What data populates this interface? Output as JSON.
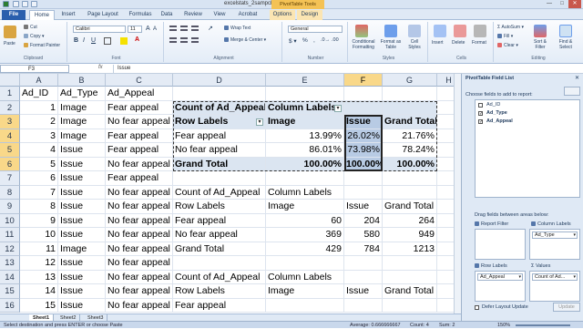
{
  "window": {
    "title": "excelstats_2sampchisq - Microsoft Excel",
    "context_tab": "PivotTable Tools",
    "controls": [
      "—",
      "□",
      "✕"
    ]
  },
  "tabs": [
    "File",
    "Home",
    "Insert",
    "Page Layout",
    "Formulas",
    "Data",
    "Review",
    "View",
    "Acrobat",
    "Options",
    "Design"
  ],
  "ribbon": {
    "clipboard": {
      "paste": "Paste",
      "cut": "Cut",
      "copy": "Copy ▾",
      "format_painter": "Format Painter",
      "label": "Clipboard"
    },
    "font": {
      "name": "Calibri",
      "size": "11",
      "label": "Font"
    },
    "alignment": {
      "wrap": "Wrap Text",
      "merge": "Merge & Center ▾",
      "label": "Alignment"
    },
    "number": {
      "format": "General",
      "label": "Number"
    },
    "styles": {
      "conditional": "Conditional Formatting",
      "format_table": "Format as Table",
      "cell_styles": "Cell Styles",
      "label": "Styles"
    },
    "cells": {
      "insert": "Insert",
      "delete": "Delete",
      "format": "Format",
      "label": "Cells"
    },
    "editing": {
      "autosum": "AutoSum ▾",
      "fill": "Fill ▾",
      "clear": "Clear ▾",
      "sort": "Sort & Filter",
      "find": "Find & Select",
      "label": "Editing"
    }
  },
  "formula_bar": {
    "name_box": "F3",
    "fx": "fx",
    "content": "Issue"
  },
  "columns": [
    "A",
    "B",
    "C",
    "D",
    "E",
    "F",
    "G",
    "H"
  ],
  "rows": [
    {
      "n": "1",
      "A": "Ad_ID",
      "B": "Ad_Type",
      "C": "Ad_Appeal",
      "D": "",
      "E": "",
      "F": "",
      "G": ""
    },
    {
      "n": "2",
      "A": "1",
      "B": "Image",
      "C": "Fear appeal",
      "D": "Count of Ad_Appeal",
      "E": "Column Labels",
      "F": "",
      "G": ""
    },
    {
      "n": "3",
      "A": "2",
      "B": "Image",
      "C": "No fear appeal",
      "D": "Row Labels",
      "E": "Image",
      "F": "Issue",
      "G": "Grand Total"
    },
    {
      "n": "4",
      "A": "3",
      "B": "Image",
      "C": "Fear appeal",
      "D": "Fear appeal",
      "E": "13.99%",
      "F": "26.02%",
      "G": "21.76%"
    },
    {
      "n": "5",
      "A": "4",
      "B": "Issue",
      "C": "Fear appeal",
      "D": "No fear appeal",
      "E": "86.01%",
      "F": "73.98%",
      "G": "78.24%"
    },
    {
      "n": "6",
      "A": "5",
      "B": "Issue",
      "C": "No fear appeal",
      "D": "Grand Total",
      "E": "100.00%",
      "F": "100.00%",
      "G": "100.00%"
    },
    {
      "n": "7",
      "A": "6",
      "B": "Issue",
      "C": "Fear appeal",
      "D": "",
      "E": "",
      "F": "",
      "G": ""
    },
    {
      "n": "8",
      "A": "7",
      "B": "Issue",
      "C": "No fear appeal",
      "D": "Count of Ad_Appeal",
      "E": "Column Labels",
      "F": "",
      "G": ""
    },
    {
      "n": "9",
      "A": "8",
      "B": "Issue",
      "C": "No fear appeal",
      "D": "Row Labels",
      "E": "Image",
      "F": "Issue",
      "G": "Grand Total"
    },
    {
      "n": "10",
      "A": "9",
      "B": "Issue",
      "C": "No fear appeal",
      "D": "Fear appeal",
      "E": "60",
      "F": "204",
      "G": "264"
    },
    {
      "n": "11",
      "A": "10",
      "B": "Issue",
      "C": "No fear appeal",
      "D": "No fear appeal",
      "E": "369",
      "F": "580",
      "G": "949"
    },
    {
      "n": "12",
      "A": "11",
      "B": "Image",
      "C": "No fear appeal",
      "D": "Grand Total",
      "E": "429",
      "F": "784",
      "G": "1213"
    },
    {
      "n": "13",
      "A": "12",
      "B": "Issue",
      "C": "No fear appeal",
      "D": "",
      "E": "",
      "F": "",
      "G": ""
    },
    {
      "n": "14",
      "A": "13",
      "B": "Issue",
      "C": "No fear appeal",
      "D": "Count of Ad_Appeal",
      "E": "Column Labels",
      "F": "",
      "G": ""
    },
    {
      "n": "15",
      "A": "14",
      "B": "Issue",
      "C": "No fear appeal",
      "D": "Row Labels",
      "E": "Image",
      "F": "Issue",
      "G": "Grand Total"
    },
    {
      "n": "16",
      "A": "15",
      "B": "Issue",
      "C": "No fear appeal",
      "D": "Fear appeal",
      "E": "",
      "F": "",
      "G": ""
    }
  ],
  "sheet_tabs": [
    "Sheet1",
    "Sheet2",
    "Sheet3"
  ],
  "status": {
    "left": "Select destination and press ENTER or choose Paste",
    "average": "Average: 0.666666667",
    "count": "Count: 4",
    "sum": "Sum: 2",
    "zoom": "150%"
  },
  "pivot_panel": {
    "title": "PivotTable Field List",
    "choose": "Choose fields to add to report:",
    "fields": [
      {
        "name": "Ad_ID",
        "checked": false
      },
      {
        "name": "Ad_Type",
        "checked": true
      },
      {
        "name": "Ad_Appeal",
        "checked": true
      }
    ],
    "drag_label": "Drag fields between areas below:",
    "report_filter": "Report Filter",
    "column_labels": "Column Labels",
    "column_value": "Ad_Type",
    "row_labels": "Row Labels",
    "row_value": "Ad_Appeal",
    "values": "Values",
    "values_value": "Count of Ad...",
    "defer": "Defer Layout Update",
    "update": "Update"
  }
}
